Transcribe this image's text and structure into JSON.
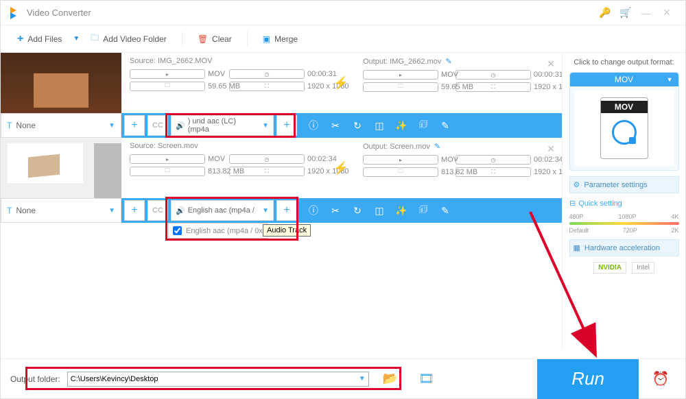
{
  "app": {
    "title": "Video Converter"
  },
  "toolbar": {
    "add_files": "Add Files",
    "add_folder": "Add Video Folder",
    "clear": "Clear",
    "merge": "Merge"
  },
  "items": [
    {
      "source_label": "Source: IMG_2662.MOV",
      "output_label": "Output: IMG_2662.mov",
      "format": "MOV",
      "duration": "00:00:31",
      "size": "59.65 MB",
      "resolution": "1920 x 1080",
      "subtitle": "None",
      "audio_track": ") und aac (LC) (mp4a"
    },
    {
      "source_label": "Source: Screen.mov",
      "output_label": "Output: Screen.mov",
      "format": "MOV",
      "duration": "00:02:34",
      "size": "813.82 MB",
      "resolution": "1920 x 1080",
      "subtitle": "None",
      "audio_track": "English aac (mp4a /",
      "audio_option": "English aac (mp4a / 0x",
      "tooltip": "Audio Track"
    }
  ],
  "right": {
    "header": "Click to change output format:",
    "format": "MOV",
    "format_band": "MOV",
    "param": "Parameter settings",
    "quick": "Quick setting",
    "quality_top": [
      "480P",
      "1080P",
      "4K"
    ],
    "quality_bot": [
      "Default",
      "720P",
      "2K"
    ],
    "hw": "Hardware acceleration",
    "nvidia": "NVIDIA",
    "intel": "Intel"
  },
  "bottom": {
    "label": "Output folder:",
    "path": "C:\\Users\\Kevincy\\Desktop",
    "run": "Run"
  }
}
